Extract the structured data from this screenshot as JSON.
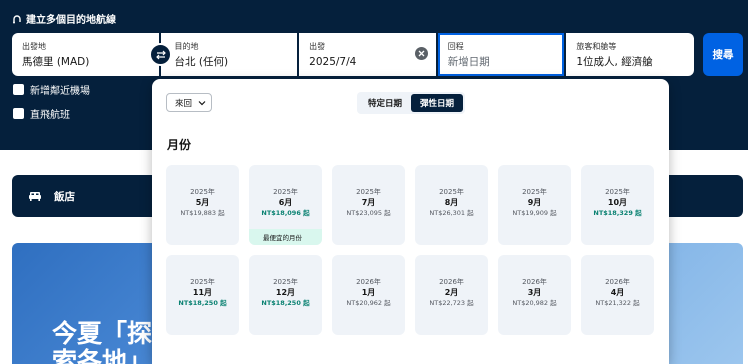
{
  "header": {
    "multi_city_label": "建立多個目的地航線"
  },
  "search": {
    "origin": {
      "label": "出發地",
      "value": "馬德里 (MAD)"
    },
    "destination": {
      "label": "目的地",
      "value": "台北 (任何)"
    },
    "depart": {
      "label": "出發",
      "value": "2025/7/4"
    },
    "return": {
      "label": "回程",
      "placeholder": "新增日期"
    },
    "travellers": {
      "label": "旅客和艙等",
      "value": "1位成人, 經濟艙"
    },
    "search_button": "搜尋"
  },
  "options": {
    "nearby_airports": "新增鄰近機場",
    "direct_flights": "直飛航班"
  },
  "hotel_bar": {
    "label": "飯店"
  },
  "promo": {
    "title": "今夏「探索各地」"
  },
  "datepicker": {
    "trip_type_select": "來回",
    "toggle": {
      "specific": "特定日期",
      "flexible": "彈性日期",
      "active": "flexible"
    },
    "months_heading": "月份",
    "cheapest_tag": "最便宜的月份",
    "cards": [
      {
        "year": "2025年",
        "month": "5月",
        "price": "NT$19,883 起",
        "cheap": false,
        "cheapest_month": false
      },
      {
        "year": "2025年",
        "month": "6月",
        "price": "NT$18,096 起",
        "cheap": true,
        "cheapest_month": true
      },
      {
        "year": "2025年",
        "month": "7月",
        "price": "NT$23,095 起",
        "cheap": false,
        "cheapest_month": false
      },
      {
        "year": "2025年",
        "month": "8月",
        "price": "NT$26,301 起",
        "cheap": false,
        "cheapest_month": false
      },
      {
        "year": "2025年",
        "month": "9月",
        "price": "NT$19,909 起",
        "cheap": false,
        "cheapest_month": false
      },
      {
        "year": "2025年",
        "month": "10月",
        "price": "NT$18,329 起",
        "cheap": true,
        "cheapest_month": false
      },
      {
        "year": "2025年",
        "month": "11月",
        "price": "NT$18,250 起",
        "cheap": true,
        "cheapest_month": false
      },
      {
        "year": "2025年",
        "month": "12月",
        "price": "NT$18,250 起",
        "cheap": true,
        "cheapest_month": false
      },
      {
        "year": "2026年",
        "month": "1月",
        "price": "NT$20,962 起",
        "cheap": false,
        "cheapest_month": false
      },
      {
        "year": "2026年",
        "month": "2月",
        "price": "NT$22,723 起",
        "cheap": false,
        "cheapest_month": false
      },
      {
        "year": "2026年",
        "month": "3月",
        "price": "NT$20,982 起",
        "cheap": false,
        "cheapest_month": false
      },
      {
        "year": "2026年",
        "month": "4月",
        "price": "NT$21,322 起",
        "cheap": false,
        "cheapest_month": false
      }
    ]
  },
  "colors": {
    "brand_dark": "#05203c",
    "accent_blue": "#0062e3",
    "cheap_price": "#0b8272",
    "card_bg": "#eff3f8"
  }
}
